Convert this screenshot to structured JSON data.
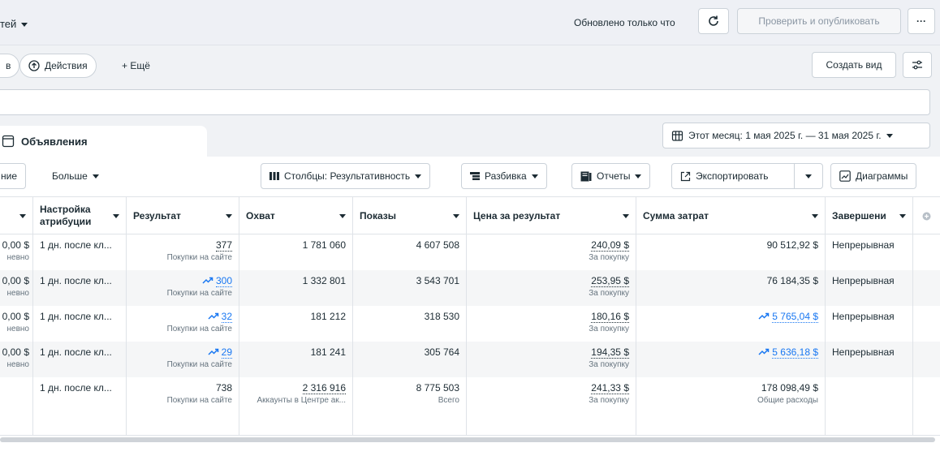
{
  "topbar": {
    "account_label": "тей",
    "updated": "Обновлено только что",
    "publish": "Проверить и опубликовать",
    "more": "···"
  },
  "row2": {
    "left_stub": "в",
    "actions": "Действия",
    "more": "+ Ещё",
    "create_view": "Создать вид"
  },
  "tabs": {
    "ads": "Объявления"
  },
  "date_range": "Этот месяц: 1 мая 2025 г. — 31 мая 2025 г.",
  "toolbar": {
    "left_stub": "ние",
    "more": "Больше",
    "columns": "Столбцы: Результативность",
    "breakdown": "Разбивка",
    "reports": "Отчеты",
    "export": "Экспортировать",
    "charts": "Диаграммы"
  },
  "columns": [
    "Настройка атрибуции",
    "Результат",
    "Охват",
    "Показы",
    "Цена за результат",
    "Сумма затрат",
    "Завершени"
  ],
  "rows": [
    {
      "budget": "0,00 $",
      "budget_sub": "невно",
      "attr": "1 дн. после кл...",
      "result": "377",
      "result_sub": "Покупки на сайте",
      "trend": false,
      "reach": "1 781 060",
      "impr": "4 607 508",
      "cpr": "240,09 $",
      "cpr_sub": "За покупку",
      "spend": "90 512,92 $",
      "spend_trend": false,
      "end": "Непрерывная"
    },
    {
      "budget": "0,00 $",
      "budget_sub": "невно",
      "attr": "1 дн. после кл...",
      "result": "300",
      "result_sub": "Покупки на сайте",
      "trend": true,
      "reach": "1 332 801",
      "impr": "3 543 701",
      "cpr": "253,95 $",
      "cpr_sub": "За покупку",
      "spend": "76 184,35 $",
      "spend_trend": false,
      "end": "Непрерывная"
    },
    {
      "budget": "0,00 $",
      "budget_sub": "невно",
      "attr": "1 дн. после кл...",
      "result": "32",
      "result_sub": "Покупки на сайте",
      "trend": true,
      "reach": "181 212",
      "impr": "318 530",
      "cpr": "180,16 $",
      "cpr_sub": "За покупку",
      "spend": "5 765,04 $",
      "spend_trend": true,
      "end": "Непрерывная"
    },
    {
      "budget": "0,00 $",
      "budget_sub": "невно",
      "attr": "1 дн. после кл...",
      "result": "29",
      "result_sub": "Покупки на сайте",
      "trend": true,
      "reach": "181 241",
      "impr": "305 764",
      "cpr": "194,35 $",
      "cpr_sub": "За покупку",
      "spend": "5 636,18 $",
      "spend_trend": true,
      "end": "Непрерывная"
    }
  ],
  "totals": {
    "attr": "1 дн. после кл...",
    "result": "738",
    "result_sub": "Покупки на сайте",
    "reach": "2 316 916",
    "reach_sub": "Аккаунты в Центре ак...",
    "impr": "8 775 503",
    "impr_sub": "Всего",
    "cpr": "241,33 $",
    "cpr_sub": "За покупку",
    "spend": "178 098,49 $",
    "spend_sub": "Общие расходы"
  },
  "colors": {
    "accent": "#1877f2",
    "text": "#1c2b33",
    "border": "#dfe3e8"
  }
}
